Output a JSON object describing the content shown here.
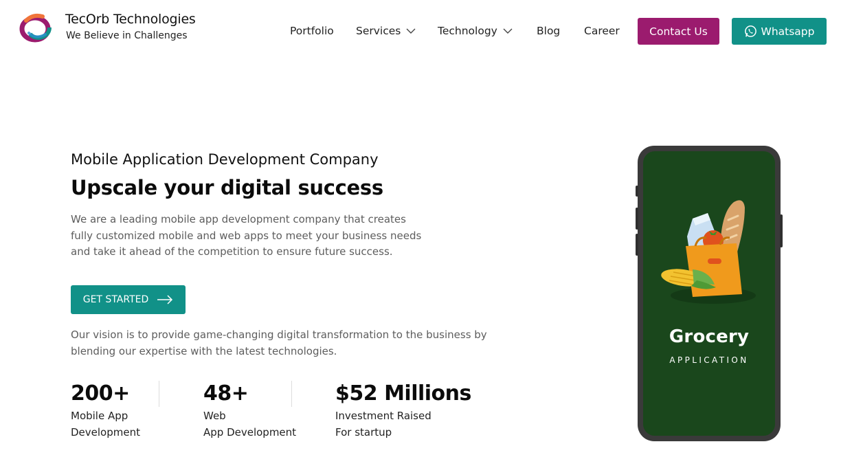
{
  "brand": {
    "name": "TecOrb Technologies",
    "tagline": "We Believe in Challenges"
  },
  "nav": {
    "items": [
      {
        "label": "Portfolio",
        "has_dropdown": false
      },
      {
        "label": "Services",
        "has_dropdown": true
      },
      {
        "label": "Technology",
        "has_dropdown": true
      },
      {
        "label": "Blog",
        "has_dropdown": false
      },
      {
        "label": "Career",
        "has_dropdown": false
      }
    ],
    "contact_label": "Contact Us",
    "whatsapp_label": "Whatsapp"
  },
  "hero": {
    "kicker": "Mobile Application Development Company",
    "title": "Upscale your digital success",
    "description": "We are a leading mobile app development company that creates fully customized mobile and web apps to meet your business needs and take it ahead of the competition to ensure future success.",
    "cta_label": "GET STARTED",
    "vision": "Our vision is to provide game-changing digital transformation to the business by blending our expertise with the latest technologies."
  },
  "stats": [
    {
      "value": "200+",
      "line1": "Mobile App",
      "line2": "Development"
    },
    {
      "value": "48+",
      "line1": "Web",
      "line2": "App Development"
    },
    {
      "value": "$52 Millions",
      "line1": "Investment Raised",
      "line2": "For startup"
    }
  ],
  "phone": {
    "title": "Grocery",
    "subtitle": "APPLICATION"
  },
  "colors": {
    "primary_teal": "#119188",
    "contact_magenta": "#9b1b6e",
    "phone_screen_green": "#1a471c"
  },
  "icons": {
    "logo": "tecorb-logo",
    "dropdown": "chevron-down-icon",
    "whatsapp": "whatsapp-icon",
    "cta_arrow": "arrow-right-icon"
  }
}
